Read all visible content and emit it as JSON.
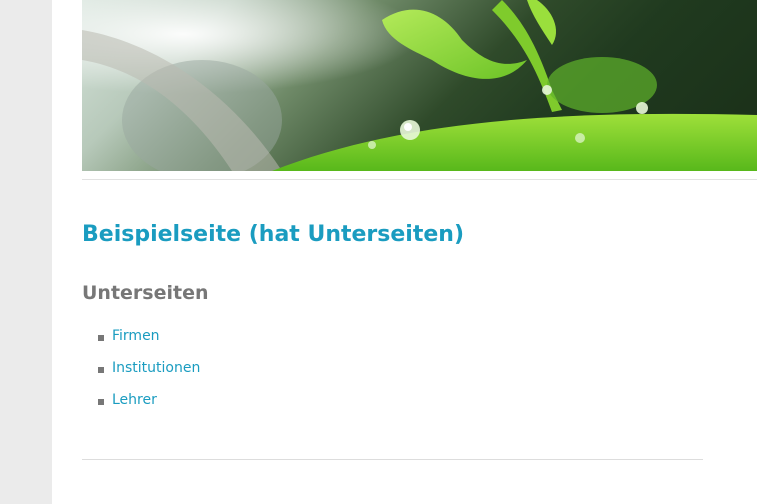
{
  "page": {
    "title": "Beispielseite (hat Unterseiten)",
    "subpages_heading": "Unterseiten",
    "subpages": [
      {
        "label": "Firmen"
      },
      {
        "label": "Institutionen"
      },
      {
        "label": "Lehrer"
      }
    ]
  },
  "colors": {
    "link": "#1a9cc0",
    "heading_gray": "#777777",
    "sidebar_bg": "#ebebeb"
  },
  "icons": {
    "list_bullet": "square-bullet-icon"
  }
}
